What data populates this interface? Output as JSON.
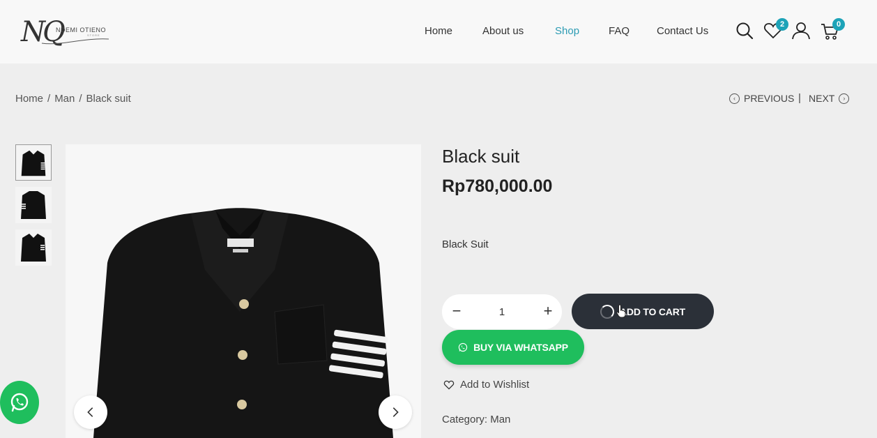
{
  "brand": {
    "monogram": "NQ",
    "name": "NDEMI OTIENO",
    "sub": "STORE"
  },
  "nav": [
    {
      "label": "Home",
      "active": false
    },
    {
      "label": "About us",
      "active": false
    },
    {
      "label": "Shop",
      "active": true
    },
    {
      "label": "FAQ",
      "active": false
    },
    {
      "label": "Contact Us",
      "active": false
    }
  ],
  "header_icons": {
    "wishlist_count": "2",
    "cart_count": "0"
  },
  "breadcrumb": [
    "Home",
    "Man",
    "Black suit"
  ],
  "breadcrumb_sep": "/",
  "pager": {
    "previous": "PREVIOUS",
    "separator": "|",
    "next": "NEXT"
  },
  "product": {
    "title": "Black suit",
    "price": "Rp780,000.00",
    "description": "Black Suit",
    "quantity": "1",
    "add_to_cart": "ADD TO CART",
    "buy_whatsapp": "BUY VIA WHATSAPP",
    "wishlist": "Add to Wishlist",
    "category_label": "Category:",
    "category_value": "Man"
  },
  "colors": {
    "accent": "#2c9bb3",
    "badge": "#1da3b8",
    "cart_button": "#2b3038",
    "whatsapp": "#1fbe5d"
  }
}
